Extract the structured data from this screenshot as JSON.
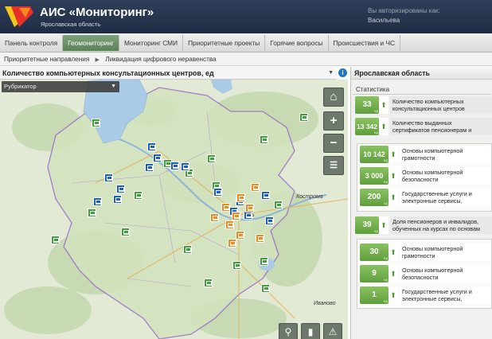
{
  "header": {
    "title": "АИС «Мониторинг»",
    "subtitle": "Ярославская область",
    "auth_label": "Вы авторизированы как:",
    "auth_user": "Васильева"
  },
  "nav": {
    "tabs": [
      {
        "label": "Панель контроля",
        "active": false
      },
      {
        "label": "Геомониторинг",
        "active": true
      },
      {
        "label": "Мониторинг СМИ",
        "active": false
      },
      {
        "label": "Приоритетные проекты",
        "active": false
      },
      {
        "label": "Горячие вопросы",
        "active": false
      },
      {
        "label": "Происшествия и ЧС",
        "active": false
      }
    ]
  },
  "breadcrumb": {
    "items": [
      "Приоритетные направления",
      "Ликвидация цифрового неравенства"
    ]
  },
  "map": {
    "layer_select": "Количество компьютерных консультационных центров, ед",
    "rubricator_label": "Рубрикатор",
    "cities": [
      "Кострома",
      "Иваново",
      "ль"
    ]
  },
  "panel": {
    "title": "Ярославская область",
    "section": "Статистика",
    "unit": "ед",
    "stats": [
      {
        "value": "33",
        "text": "Количество компьютерных консультационных центров"
      },
      {
        "value": "13 342",
        "text": "Количество выданных сертификатов пенсионерам и инвалидам"
      },
      {
        "value": "10 142",
        "text": "Основы компьютерной грамотности"
      },
      {
        "value": "3 000",
        "text": "Основы компьютерной безопасности"
      },
      {
        "value": "200",
        "text": "Государственные услуги и электронные сервисы,"
      },
      {
        "value": "39",
        "text": "Доля пенсионеров и инвалидов, обученных на курсах по основам"
      },
      {
        "value": "30",
        "text": "Основы компьютерной грамотности"
      },
      {
        "value": "9",
        "text": "Основы компьютерной безопасности"
      },
      {
        "value": "1",
        "text": "Государственные услуги и электронные сервисы,"
      }
    ]
  },
  "colors": {
    "header_bg": "#243350",
    "active_tab": "#6a8f66",
    "stat_green": "#6aab45",
    "marker_green": "#3da23a",
    "marker_blue": "#1a5fc9",
    "marker_orange": "#f08a1c"
  },
  "icons": [
    "logo-icon",
    "info-icon",
    "home-icon",
    "zoom-in-icon",
    "zoom-out-icon",
    "legend-icon",
    "arrow-up-icon",
    "monitor-marker-icon",
    "chevron-down-icon",
    "warning-icon"
  ]
}
